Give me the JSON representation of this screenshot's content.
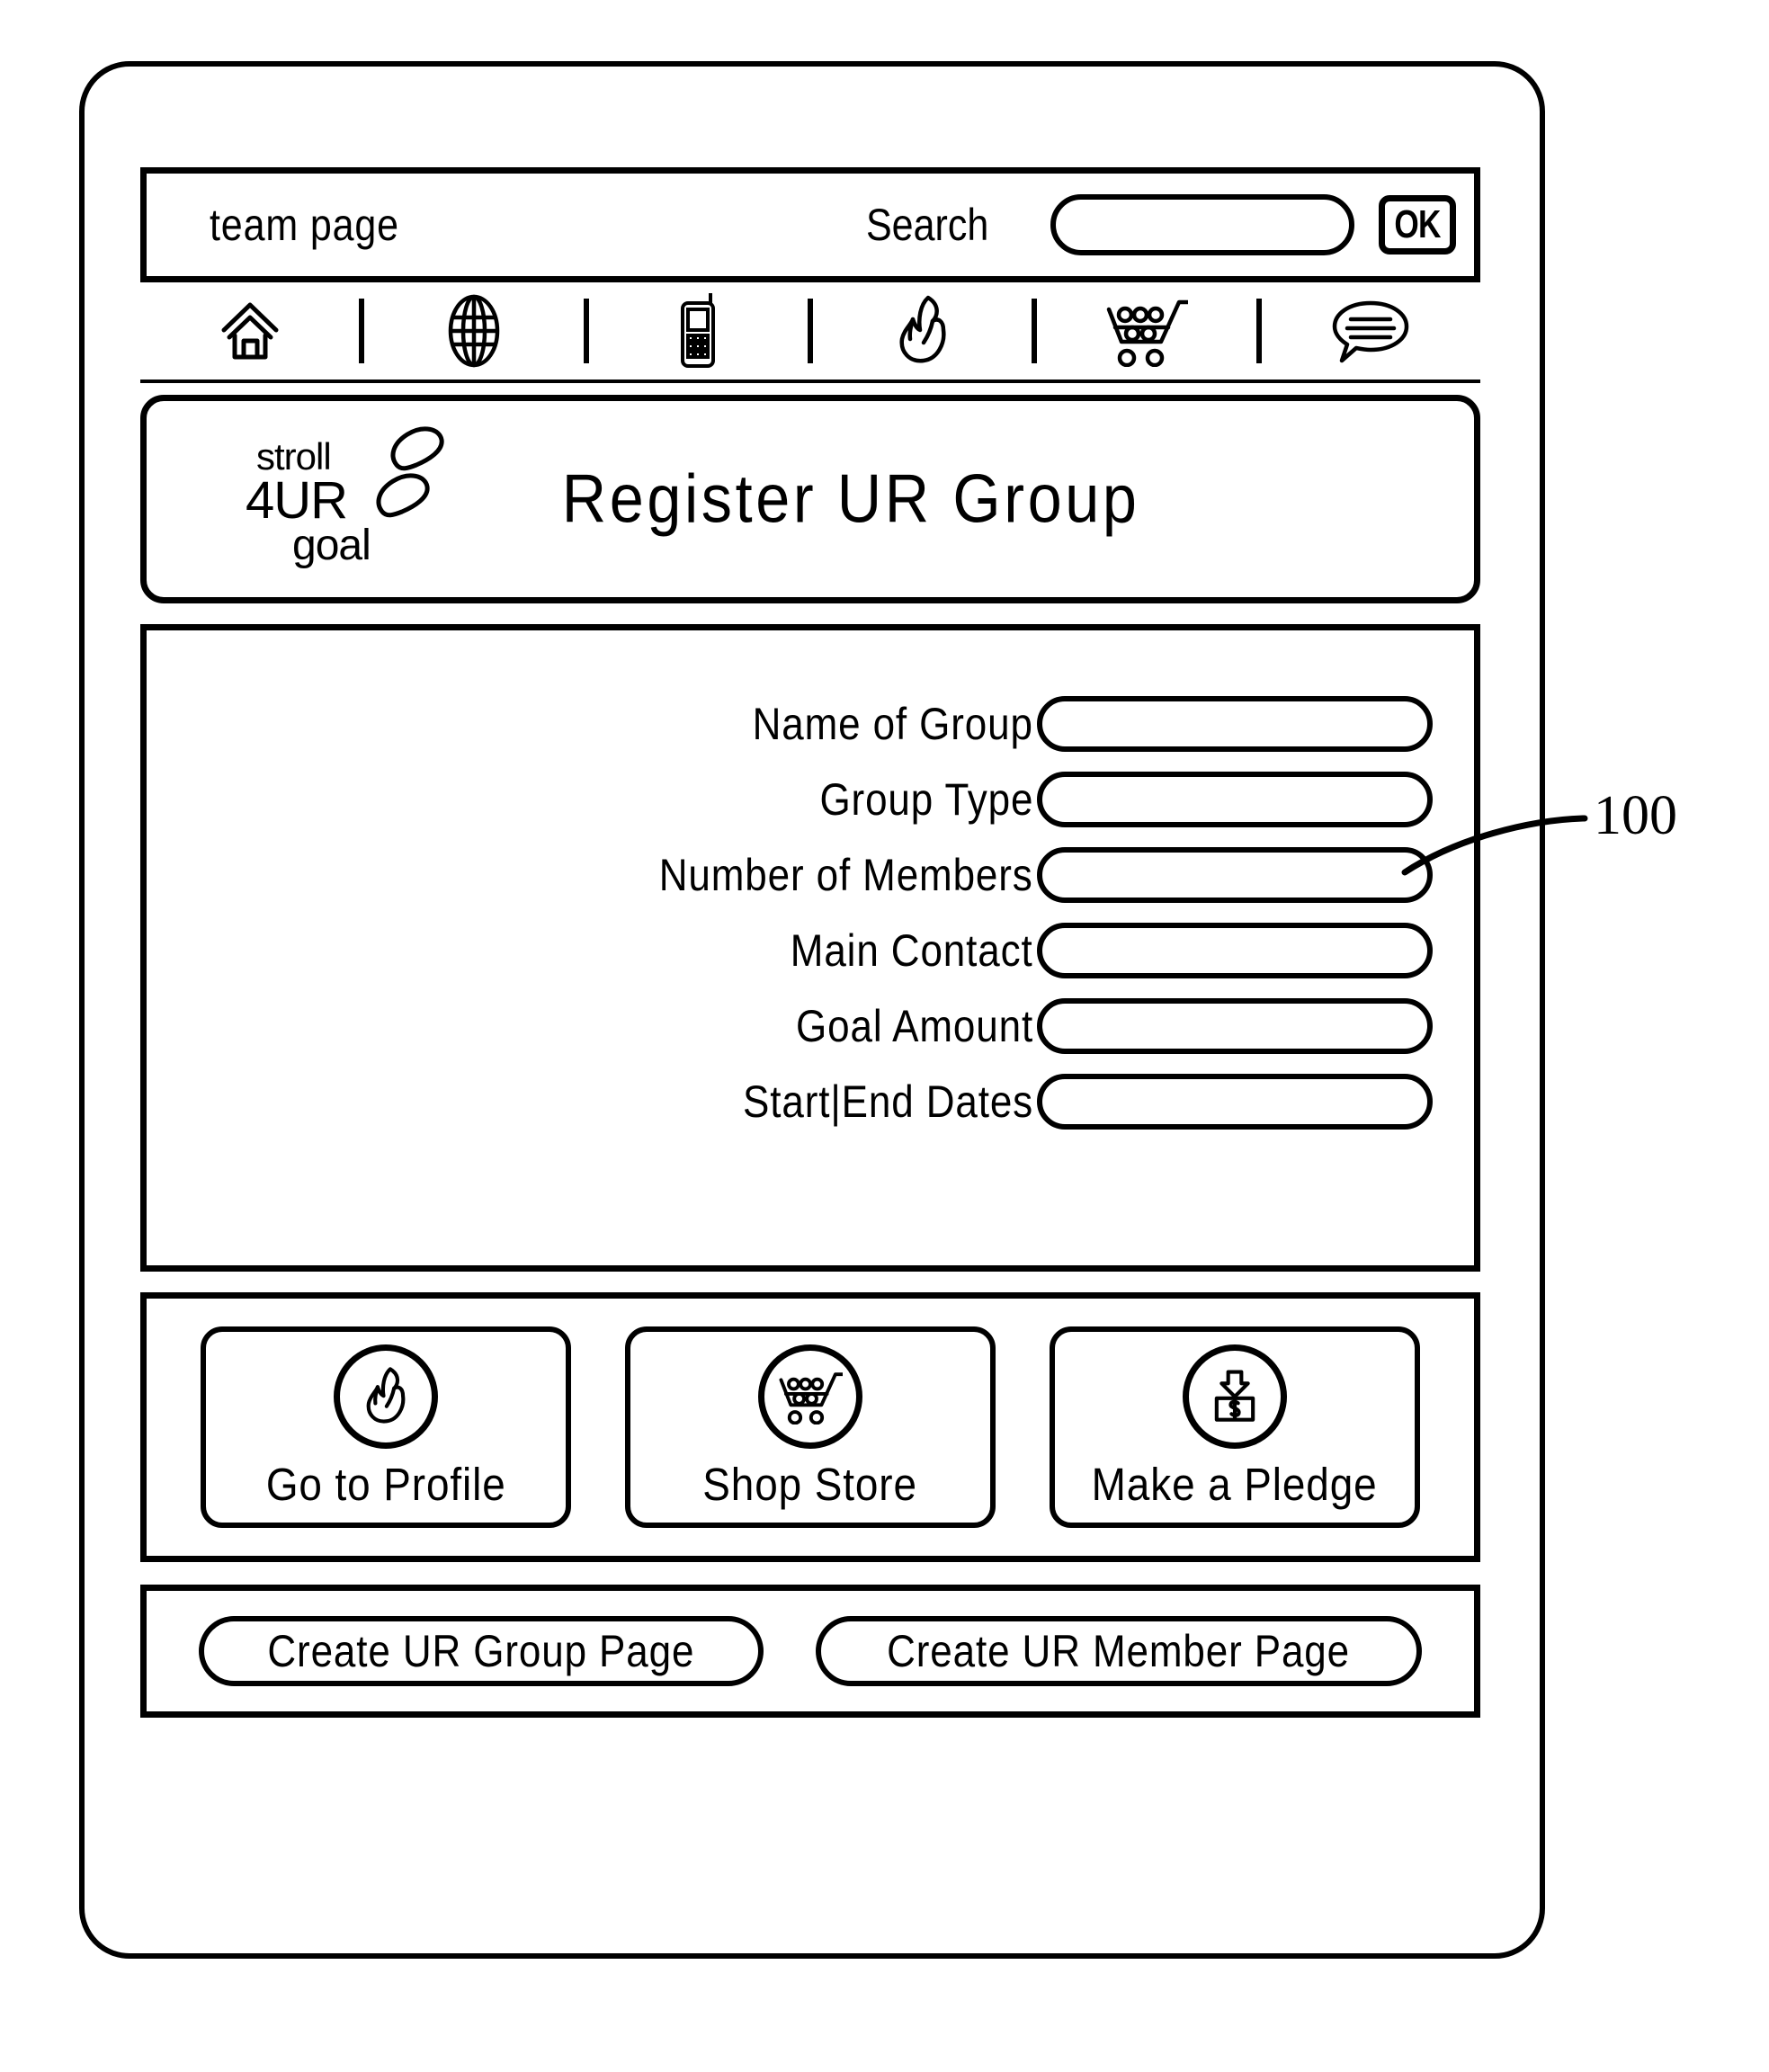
{
  "top_bar": {
    "page_label": "team page",
    "search_label": "Search",
    "search_value": "",
    "search_placeholder": "",
    "ok_label": "OK"
  },
  "toolbar": {
    "icons": [
      {
        "name": "home-icon",
        "label": "Home"
      },
      {
        "name": "globe-icon",
        "label": "Web"
      },
      {
        "name": "mobile-phone-icon",
        "label": "Mobile"
      },
      {
        "name": "flame-icon",
        "label": "Profile"
      },
      {
        "name": "shopping-cart-icon",
        "label": "Store"
      },
      {
        "name": "speech-bubble-icon",
        "label": "Messages"
      }
    ]
  },
  "title_panel": {
    "logo": {
      "line1": "stroll",
      "line2": "4UR",
      "line3": "goal",
      "mark": "footprints-icon"
    },
    "title": "Register UR Group"
  },
  "form": {
    "fields": [
      {
        "label": "Name of Group",
        "value": "",
        "name": "name-of-group"
      },
      {
        "label": "Group Type",
        "value": "",
        "name": "group-type"
      },
      {
        "label": "Number of Members",
        "value": "",
        "name": "number-of-members"
      },
      {
        "label": "Main Contact",
        "value": "",
        "name": "main-contact"
      },
      {
        "label": "Goal Amount",
        "value": "",
        "name": "goal-amount"
      },
      {
        "label": "Start|End Dates",
        "value": "",
        "name": "start-end-dates"
      }
    ]
  },
  "actions": {
    "buttons": [
      {
        "label": "Go to Profile",
        "icon": "flame-icon",
        "name": "go-to-profile"
      },
      {
        "label": "Shop Store",
        "icon": "shopping-cart-icon",
        "name": "shop-store"
      },
      {
        "label": "Make a Pledge",
        "icon": "deposit-money-icon",
        "name": "make-a-pledge"
      }
    ]
  },
  "bottom": {
    "buttons": [
      {
        "label": "Create UR Group Page",
        "name": "create-ur-group-page"
      },
      {
        "label": "Create UR Member Page",
        "name": "create-ur-member-page"
      }
    ]
  },
  "callout": {
    "reference_number": "100"
  },
  "colors": {
    "ink": "#000000",
    "paper": "#ffffff"
  }
}
